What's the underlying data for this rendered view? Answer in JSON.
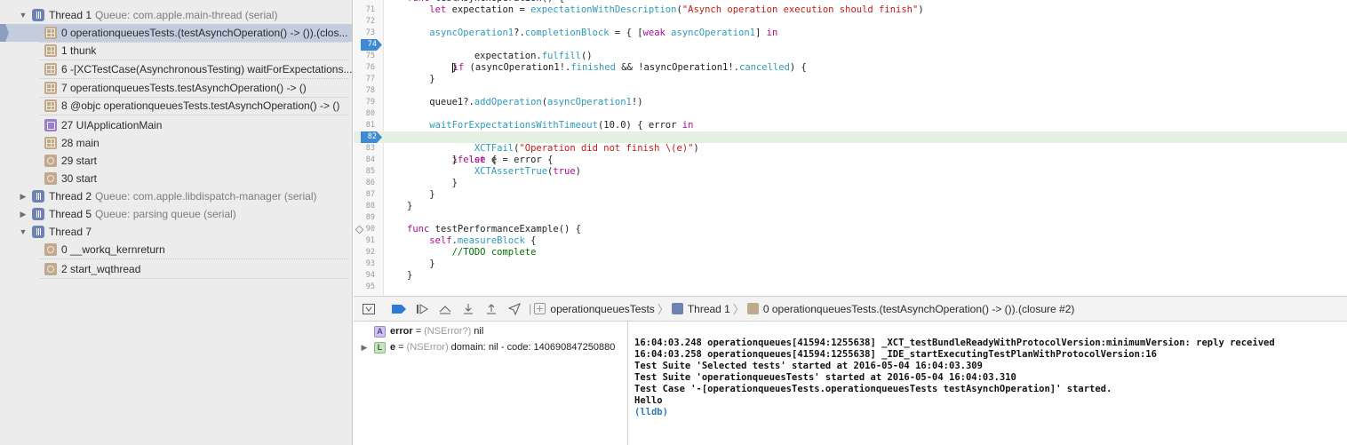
{
  "navigator": {
    "threads": [
      {
        "label": "Thread 1",
        "queue": "Queue: com.apple.main-thread (serial)",
        "expanded": true
      },
      {
        "label": "Thread 2",
        "queue": "Queue: com.apple.libdispatch-manager (serial)",
        "expanded": false
      },
      {
        "label": "Thread 5",
        "queue": "Queue: parsing queue (serial)",
        "expanded": false
      },
      {
        "label": "Thread 7",
        "queue": "",
        "expanded": true
      }
    ],
    "thread1_frames": [
      {
        "label": "0 operationqueuesTests.(testAsynchOperation() -> ()).(clos...",
        "icon": "stack-frame-icon",
        "selected": true
      },
      {
        "label": "1 thunk",
        "icon": "stack-frame-icon"
      },
      {
        "label": "6 -[XCTestCase(AsynchronousTesting) waitForExpectations...",
        "icon": "stack-frame-icon"
      },
      {
        "label": "7 operationqueuesTests.testAsynchOperation() -> ()",
        "icon": "stack-frame-icon"
      },
      {
        "label": "8 @objc operationqueuesTests.testAsynchOperation() -> ()",
        "icon": "stack-frame-icon"
      },
      {
        "label": "27 UIApplicationMain",
        "icon": "framework-frame-icon"
      },
      {
        "label": "28 main",
        "icon": "stack-frame-icon"
      },
      {
        "label": "29 start",
        "icon": "system-frame-icon"
      },
      {
        "label": "30 start",
        "icon": "system-frame-icon"
      }
    ],
    "thread7_frames": [
      {
        "label": "0 __workq_kernreturn",
        "icon": "system-frame-icon"
      },
      {
        "label": "2 start_wqthread",
        "icon": "system-frame-icon"
      }
    ]
  },
  "editor": {
    "line_numbers": [
      "71",
      "72",
      "73",
      "74",
      "75",
      "76",
      "77",
      "78",
      "79",
      "80",
      "81",
      "82",
      "83",
      "84",
      "85",
      "86",
      "87",
      "88",
      "89",
      "90",
      "91",
      "92",
      "93",
      "94",
      "95"
    ],
    "breakpoint_line": "74",
    "current_line": "82"
  },
  "debug_bar": {
    "breadcrumbs": [
      "operationqueuesTests",
      "Thread 1",
      "0 operationqueuesTests.(testAsynchOperation() -> ()).(closure #2)"
    ]
  },
  "variables": [
    {
      "badge": "A",
      "name": "error",
      "type": "(NSError?)",
      "value": "nil",
      "expandable": false
    },
    {
      "badge": "L",
      "name": "e",
      "type": "(NSError)",
      "value": "domain: nil - code: 140690847250880",
      "expandable": true
    }
  ],
  "console": {
    "lines": [
      "16:04:03.248 operationqueues[41594:1255638] _XCT_testBundleReadyWithProtocolVersion:minimumVersion: reply received",
      "16:04:03.258 operationqueues[41594:1255638] _IDE_startExecutingTestPlanWithProtocolVersion:16",
      "Test Suite 'Selected tests' started at 2016-05-04 16:04:03.309",
      "Test Suite 'operationqueuesTests' started at 2016-05-04 16:04:03.310",
      "Test Case '-[operationqueuesTests.operationqueuesTests testAsynchOperation]' started.",
      "Hello"
    ],
    "prompt": "(lldb)"
  },
  "colors": {
    "selection": "#c4cddd",
    "current_line": "#e4f1e2",
    "breakpoint": "#3f8ad3",
    "keyword": "#aa0d91",
    "identifier": "#2e9ab8",
    "string": "#c41a16",
    "comment": "#007400"
  }
}
